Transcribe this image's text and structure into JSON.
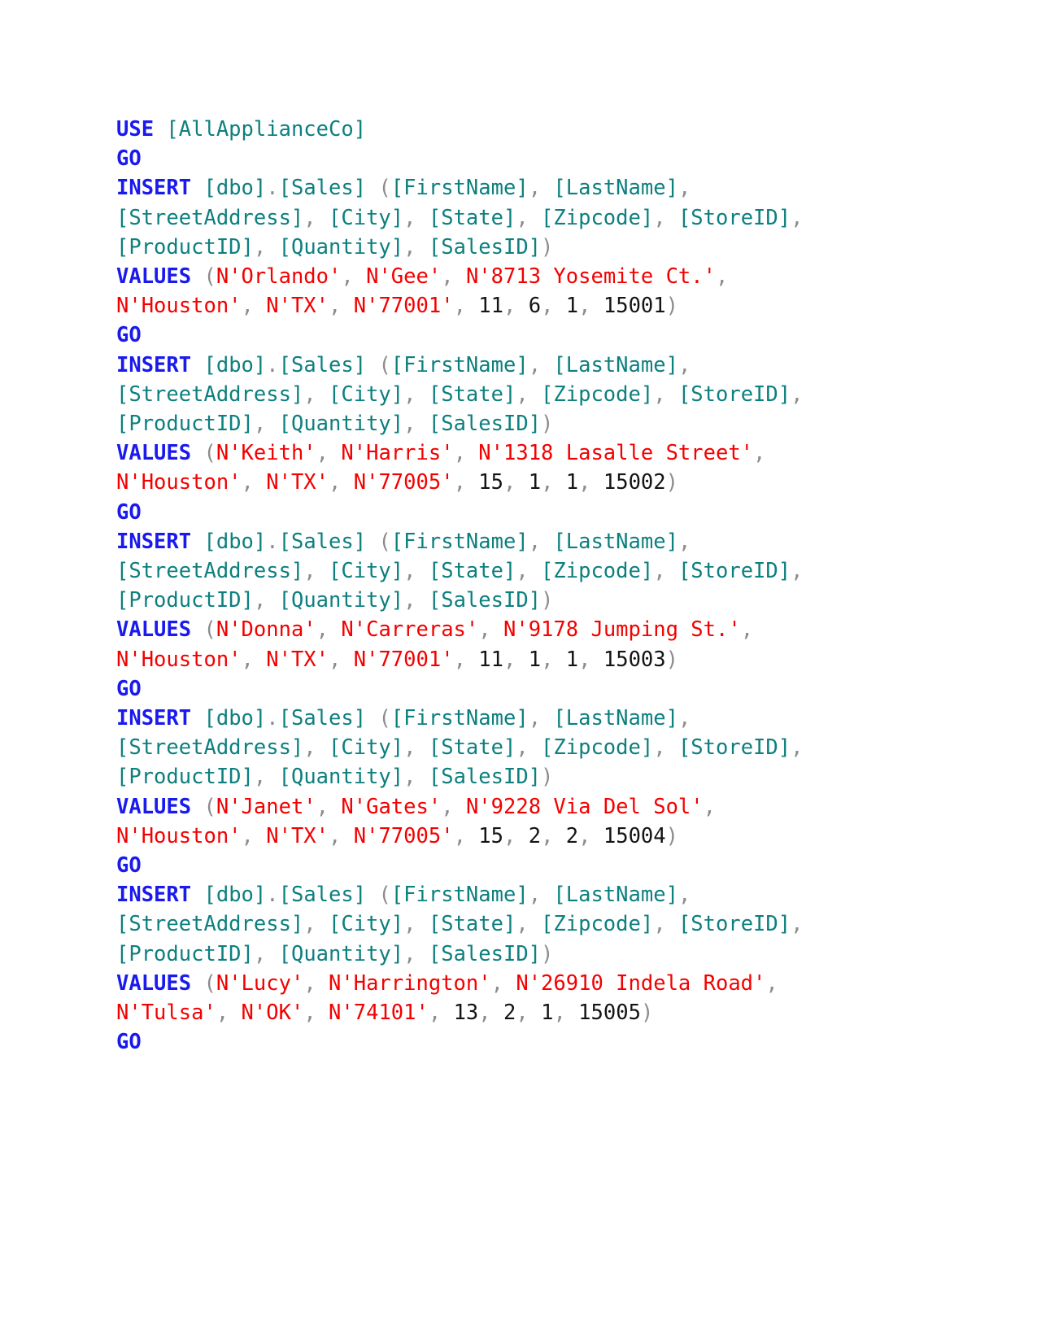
{
  "document": {
    "type": "sql-script",
    "language": "T-SQL",
    "database": "AllApplianceCo",
    "table": "[dbo].[Sales]",
    "colors": {
      "keyword": "#1a1aee",
      "identifier": "#0d7f7f",
      "string": "#f40000",
      "number": "#141414",
      "punctuation": "#8c8c8c",
      "background": "#ffffff"
    },
    "keywords": {
      "use": "USE",
      "go": "GO",
      "insert": "INSERT",
      "values": "VALUES"
    },
    "database_bracket": "[AllApplianceCo]",
    "table_schema": "[dbo]",
    "table_name": "[Sales]",
    "dot": ".",
    "open_paren": "(",
    "close_paren": ")",
    "comma": ",",
    "space": " ",
    "columns": [
      "[FirstName]",
      "[LastName]",
      "[StreetAddress]",
      "[City]",
      "[State]",
      "[Zipcode]",
      "[StoreID]",
      "[ProductID]",
      "[Quantity]",
      "[SalesID]"
    ],
    "records": [
      {
        "FirstName": "N'Orlando'",
        "LastName": "N'Gee'",
        "StreetAddress": "N'8713 Yosemite Ct.'",
        "City": "N'Houston'",
        "State": "N'TX'",
        "Zipcode": "N'77001'",
        "StoreID": "11",
        "ProductID": "6",
        "Quantity": "1",
        "SalesID": "15001"
      },
      {
        "FirstName": "N'Keith'",
        "LastName": "N'Harris'",
        "StreetAddress": "N'1318 Lasalle Street'",
        "City": "N'Houston'",
        "State": "N'TX'",
        "Zipcode": "N'77005'",
        "StoreID": "15",
        "ProductID": "1",
        "Quantity": "1",
        "SalesID": "15002"
      },
      {
        "FirstName": "N'Donna'",
        "LastName": "N'Carreras'",
        "StreetAddress": "N'9178 Jumping St.'",
        "City": "N'Houston'",
        "State": "N'TX'",
        "Zipcode": "N'77001'",
        "StoreID": "11",
        "ProductID": "1",
        "Quantity": "1",
        "SalesID": "15003"
      },
      {
        "FirstName": "N'Janet'",
        "LastName": "N'Gates'",
        "StreetAddress": "N'9228 Via Del Sol'",
        "City": "N'Houston'",
        "State": "N'TX'",
        "Zipcode": "N'77005'",
        "StoreID": "15",
        "ProductID": "2",
        "Quantity": "2",
        "SalesID": "15004"
      },
      {
        "FirstName": "N'Lucy'",
        "LastName": "N'Harrington'",
        "StreetAddress": "N'26910 Indela Road'",
        "City": "N'Tulsa'",
        "State": "N'OK'",
        "Zipcode": "N'74101'",
        "StoreID": "13",
        "ProductID": "2",
        "Quantity": "1",
        "SalesID": "15005"
      }
    ]
  }
}
